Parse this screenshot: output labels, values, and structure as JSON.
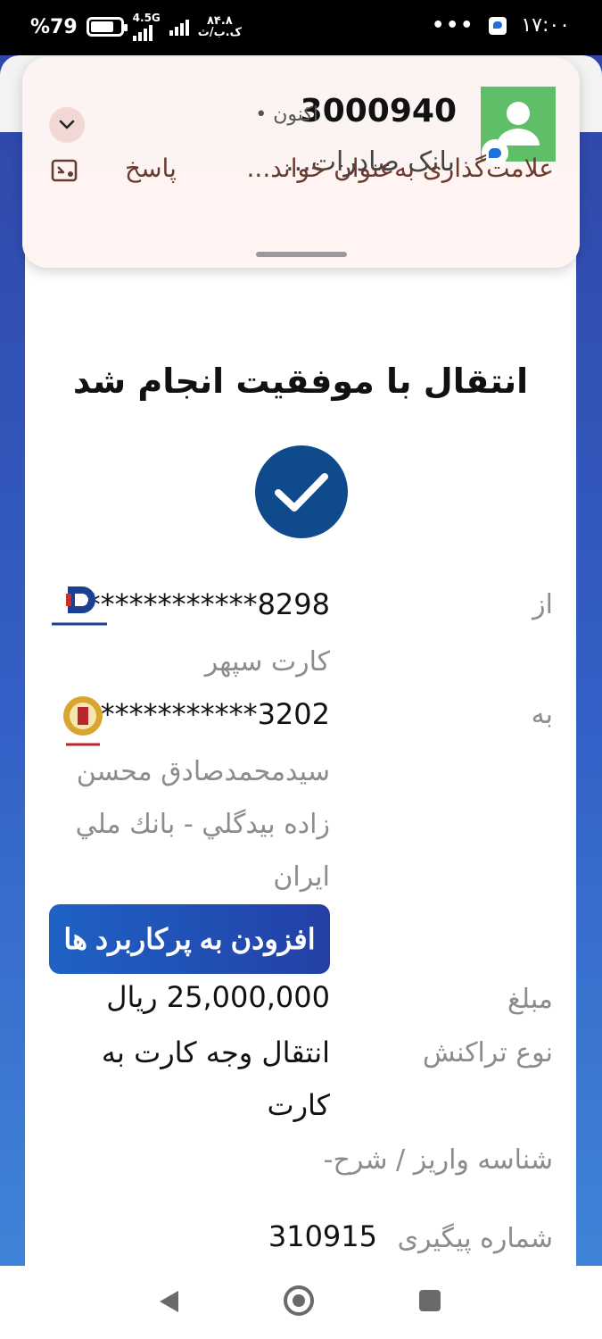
{
  "status_bar": {
    "battery": "79",
    "battery_suffix": "%",
    "battery_level": 0.79,
    "network": "4.5G",
    "data_speed": "۸۴.۸",
    "data_speed_unit": "ک.ب/ث",
    "time": "۱۷:۰۰",
    "overflow": "•••"
  },
  "notification": {
    "sender": "3000940",
    "separator": "•",
    "time": "اکنون",
    "preview": "بانک صادرات...",
    "actions": {
      "mark_read": "علامت‌گذاری به‌عنوان خواند...",
      "reply": "پاسخ"
    },
    "icons": [
      "expand-chevron-icon",
      "contact-avatar-icon",
      "message-app-badge-icon",
      "mark-read-icon"
    ]
  },
  "receipt": {
    "title": "انتقال با موفقیت انجام شد",
    "from": {
      "label": "از",
      "card": "************8298",
      "card_type": "کارت سپهر",
      "bank_logo": "بانک صادرات ایران"
    },
    "to": {
      "label": "به",
      "card": "************3202",
      "owner_line1": "سیدمحمدصادق محسن",
      "owner_line2": "زاده بیدگلي - بانك ملي",
      "owner_line3": "ایران",
      "bank_logo": "بانک ملی"
    },
    "add_favorite_button": "افزودن به پرکاربرد ها",
    "amount": {
      "label": "مبلغ",
      "value": "25,000,000",
      "unit": "ریال"
    },
    "transaction_type": {
      "label": "نوع تراکنش",
      "value_line1": "انتقال وجه کارت به",
      "value_line2": "کارت"
    },
    "deposit_id": {
      "label": "شناسه واریز / شرح",
      "value": "-"
    },
    "tracking": {
      "label": "شماره پیگیری",
      "value": "310915"
    }
  },
  "colors": {
    "app_gradient_top": "#2f46a8",
    "app_gradient_bottom": "#3f84d9",
    "check_circle": "#0e4a8c",
    "notification_bg": "#fbf4f3",
    "notification_action_text": "#6b3a2e"
  }
}
